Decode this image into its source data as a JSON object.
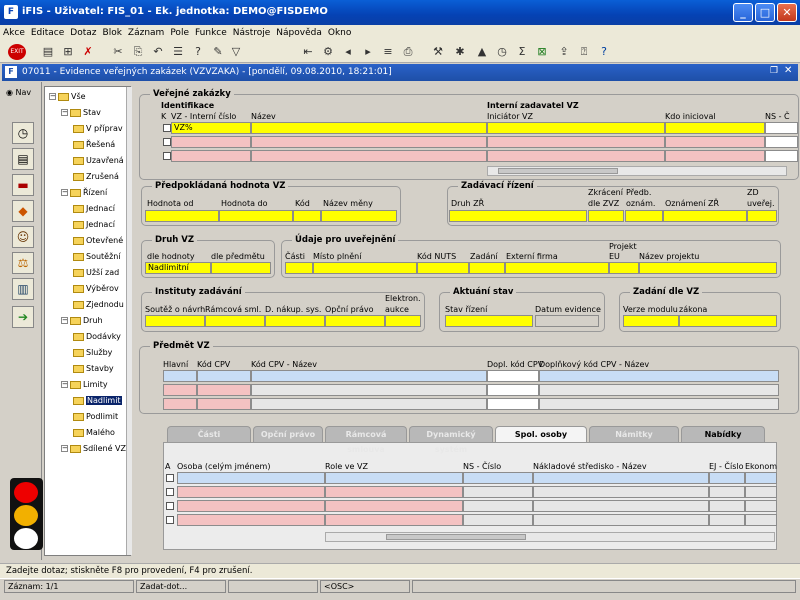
{
  "app": {
    "title": "iFIS - Uživatel: FIS_01 - Ek. jednotka: DEMO@FISDEMO",
    "icon": "F"
  },
  "menu": [
    "Akce",
    "Editace",
    "Dotaz",
    "Blok",
    "Záznam",
    "Pole",
    "Funkce",
    "Nástroje",
    "Nápověda",
    "Okno"
  ],
  "toolbar_icons": [
    "exit-icon",
    "save-icon",
    "insert-icon",
    "delete-icon",
    "scissors-icon",
    "copy-icon",
    "filter-icon",
    "undo-icon",
    "query-icon",
    "execute-icon",
    "first-icon",
    "list-icon",
    "prev-icon",
    "next-icon",
    "tools-icon",
    "settings-icon",
    "print-icon",
    "calc-icon",
    "sum-icon",
    "excel-icon",
    "export-icon",
    "help-icon",
    "info-icon"
  ],
  "form": {
    "title": "07011 - Evidence veřejných zakázek (VZVZAKA) - [pondělí, 09.08.2010, 18:21:01]"
  },
  "nav": {
    "label": "Nav"
  },
  "tree": {
    "items": [
      {
        "label": "Vše",
        "level": 0
      },
      {
        "label": "Stav",
        "level": 1
      },
      {
        "label": "V příprav",
        "level": 2
      },
      {
        "label": "Řešená",
        "level": 2
      },
      {
        "label": "Uzavřená",
        "level": 2
      },
      {
        "label": "Zrušená",
        "level": 2
      },
      {
        "label": "Řízení",
        "level": 1
      },
      {
        "label": "Jednací",
        "level": 2
      },
      {
        "label": "Jednací",
        "level": 2
      },
      {
        "label": "Otevřené",
        "level": 2
      },
      {
        "label": "Soutěžní",
        "level": 2
      },
      {
        "label": "Užší zad",
        "level": 2
      },
      {
        "label": "Výběrov",
        "level": 2
      },
      {
        "label": "Zjednodu",
        "level": 2
      },
      {
        "label": "Druh",
        "level": 1
      },
      {
        "label": "Dodávky",
        "level": 2
      },
      {
        "label": "Služby",
        "level": 2
      },
      {
        "label": "Stavby",
        "level": 2
      },
      {
        "label": "Limity",
        "level": 1
      },
      {
        "label": "Nadlimit",
        "level": 2,
        "selected": true
      },
      {
        "label": "Podlimit",
        "level": 2
      },
      {
        "label": "Malého",
        "level": 2
      },
      {
        "label": "Sdílené VZ",
        "level": 1
      }
    ]
  },
  "vz": {
    "title": "Veřejné zakázky",
    "identifikace": "Identifikace",
    "k_col": "K",
    "id_col": "VZ - Interní číslo",
    "name_col": "Název",
    "interni_zadavatel": "Interní zadavatel VZ",
    "iniciator": "Iniciátor VZ",
    "kdo_inicioval": "Kdo inicioval",
    "ns_col": "NS - Č",
    "row1_id": "VZ%"
  },
  "hodnota": {
    "title": "Předpokládaná hodnota VZ",
    "od": "Hodnota od",
    "do": "Hodnota do",
    "kod": "Kód",
    "mena": "Název měny"
  },
  "rizeni": {
    "title": "Zadávací řízení",
    "druh": "Druh ZŘ",
    "zkraceni": "Zkrácení",
    "dle_zvz": "dle ZVZ",
    "predb": "Předb.",
    "oznam": "oznám.",
    "oznameni_zr": "Oznámení ZŘ",
    "zd": "ZD",
    "uverej": "uveřej."
  },
  "druh": {
    "title": "Druh VZ",
    "dle_hodnoty": "dle hodnoty",
    "dle_predmetu": "dle předmětu",
    "value": "Nadlimitní"
  },
  "udaje": {
    "title": "Údaje pro uveřejnění",
    "casti": "Části",
    "misto": "Místo plnění",
    "nuts": "Kód NUTS",
    "zadani": "Zadání",
    "externi": "Externí firma",
    "projekt": "Projekt",
    "eu": "EU",
    "nazev_projektu": "Název projektu"
  },
  "instituty": {
    "title": "Instituty zadávání",
    "soutez": "Soutěž o návrh",
    "ramcova": "Rámcová sml.",
    "dns": "D. nákup. sys.",
    "opcni": "Opční právo",
    "elektron": "Elektron.",
    "aukce": "aukce"
  },
  "stav": {
    "title": "Aktuání stav",
    "stav_rizeni": "Stav řízení",
    "datum": "Datum evidence"
  },
  "zadani_dle": {
    "title": "Zadání dle VZ",
    "verze": "Verze modulu",
    "zakona": "zákona"
  },
  "predmet": {
    "title": "Předmět VZ",
    "hlavni": "Hlavní",
    "kod_cpv": "Kód CPV",
    "kod_cpv_nazev": "Kód CPV - Název",
    "dopl": "Dopl. kód CPV",
    "dopl_nazev": "Doplňkový kód CPV - Název"
  },
  "tabs": [
    {
      "label": "Části",
      "state": "disabled"
    },
    {
      "label": "Opční právo",
      "state": "disabled"
    },
    {
      "label": "Rámcová smlouva",
      "state": "disabled"
    },
    {
      "label": "Dynamický systém",
      "state": "disabled"
    },
    {
      "label": "Spol. osoby",
      "state": "active"
    },
    {
      "label": "Námitky",
      "state": "disabled"
    },
    {
      "label": "Nabídky",
      "state": "enabled"
    }
  ],
  "osoby": {
    "a": "A",
    "osoba": "Osoba (celým jménem)",
    "role": "Role ve VZ",
    "ns": "NS - Číslo",
    "nakladove": "Nákladové středisko - Název",
    "ej": "EJ - Číslo",
    "ekonom": "Ekonom"
  },
  "status": {
    "message": "Zadejte dotaz; stiskněte F8 pro provedení, F4 pro zrušení.",
    "record": "Záznam: 1/1",
    "mode": "Zadat-dot...",
    "osc": "<OSC>"
  },
  "colors": {
    "yellow": "#ffff00",
    "pink": "#f4c2c2",
    "blue": "#c8ddf5",
    "title": "#0542b4"
  }
}
